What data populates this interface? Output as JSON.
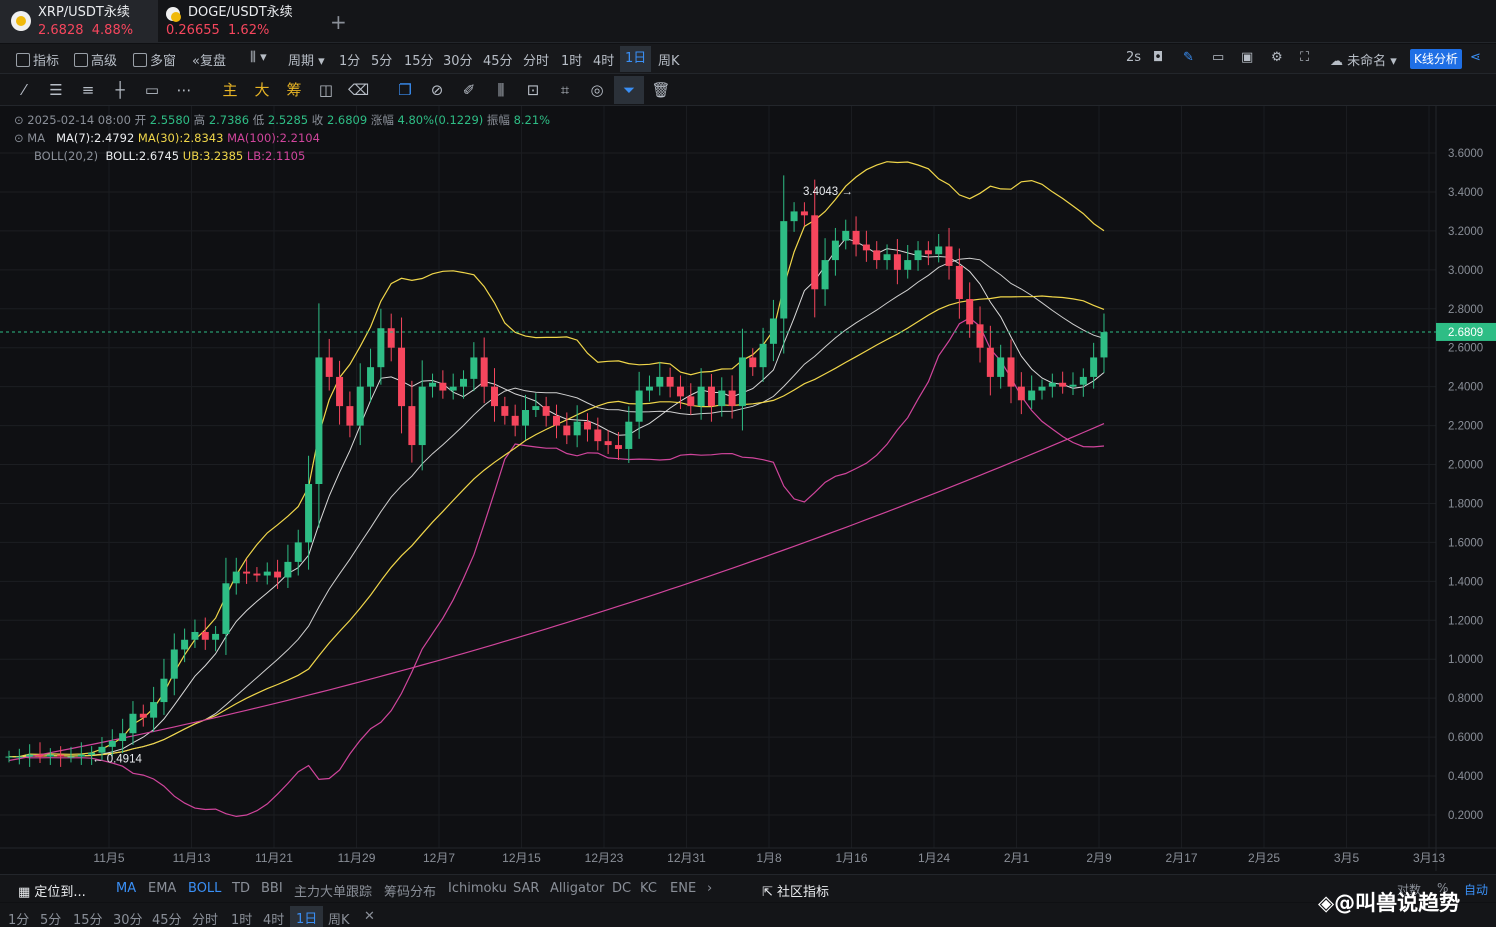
{
  "tabs": [
    {
      "symbol": "XRP/USDT永续",
      "price": "2.6828",
      "change": "4.88%"
    },
    {
      "symbol": "DOGE/USDT永续",
      "price": "0.26655",
      "change": "1.62%"
    }
  ],
  "toolbar": {
    "indicator": "指标",
    "advanced": "高级",
    "multi": "多窗",
    "adjust": "复盘",
    "period": "周期",
    "intervals": [
      "1分",
      "5分",
      "15分",
      "30分",
      "45分",
      "分时",
      "1时",
      "4时",
      "1日",
      "周K"
    ],
    "selected_interval": "1日",
    "refresh": "2s",
    "unnamed": "未命名",
    "kline_analysis": "K线分析"
  },
  "draw_tools": {
    "main": "主",
    "big": "大",
    "chips": "筹"
  },
  "info": {
    "date": "2025-02-14 08:00",
    "open_label": "开",
    "open": "2.5580",
    "high_label": "高",
    "high": "2.7386",
    "low_label": "低",
    "low": "2.5285",
    "close_label": "收",
    "close": "2.6809",
    "chg_label": "涨幅",
    "chg": "4.80%(0.1229)",
    "amp_label": "振幅",
    "amp": "8.21%",
    "ma_label": "MA",
    "ma7": "MA(7):2.4792",
    "ma30": "MA(30):2.8343",
    "ma100": "MA(100):2.2104",
    "boll_label": "BOLL(20,2)",
    "boll": "BOLL:2.6745",
    "ub": "UB:3.2385",
    "lb": "LB:2.1105"
  },
  "chart_data": {
    "type": "candlestick",
    "price_axis": [
      "3.6000",
      "3.4000",
      "3.2000",
      "3.0000",
      "2.8000",
      "2.6000",
      "2.4000",
      "2.2000",
      "2.0000",
      "1.8000",
      "1.6000",
      "1.4000",
      "1.2000",
      "1.0000",
      "0.8000",
      "0.6000",
      "0.4000",
      "0.2000"
    ],
    "date_axis": [
      "11月5",
      "11月13",
      "11月21",
      "11月29",
      "12月7",
      "12月15",
      "12月23",
      "12月31",
      "1月8",
      "1月16",
      "1月24",
      "2月1",
      "2月9",
      "2月17",
      "2月25",
      "3月5",
      "3月13"
    ],
    "current_price": "2.6809",
    "high_mark": "3.4043",
    "low_mark": "0.4914",
    "colors": {
      "up": "#2ebd85",
      "down": "#f6465d",
      "ma7": "#d9d9d9",
      "ma30": "#f0d64a",
      "ma100": "#d0459c",
      "boll": "#f0d64a"
    }
  },
  "bottom": {
    "locate": "定位到...",
    "indicators": [
      "MA",
      "EMA",
      "BOLL",
      "TD",
      "BBI",
      "主力大单跟踪",
      "筹码分布",
      "Ichimoku",
      "SAR",
      "Alligator",
      "DC",
      "KC",
      "ENE"
    ],
    "community": "社区指标",
    "intervals": [
      "1分",
      "5分",
      "15分",
      "30分",
      "45分",
      "分时",
      "1时",
      "4时",
      "1日",
      "周K"
    ],
    "right": [
      "对数",
      "%",
      "自动"
    ]
  },
  "watermark": "@叫兽说趋势"
}
